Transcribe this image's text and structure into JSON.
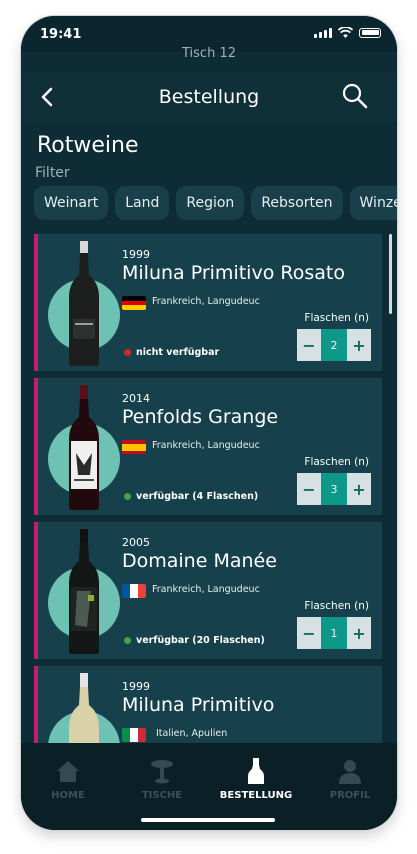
{
  "status_bar": {
    "time": "19:41"
  },
  "table_label": "Tisch 12",
  "header": {
    "title": "Bestellung"
  },
  "section": {
    "title": "Rotweine",
    "filter_label": "Filter"
  },
  "filters": [
    "Weinart",
    "Land",
    "Region",
    "Rebsorten",
    "Winze"
  ],
  "wines": [
    {
      "year": "1999",
      "name": "Miluna Primitivo Rosato",
      "origin": "Frankreich, Langudeuc",
      "flag": "de-flag-icon",
      "status": "nicht verfügbar",
      "status_color": "#d22a2a",
      "qty_label": "Flaschen (n)",
      "qty": "2",
      "bottle": "white"
    },
    {
      "year": "2014",
      "name": "Penfolds Grange",
      "origin": "Frankreich, Langudeuc",
      "flag": "es-flag-icon",
      "status": "verfügbar (4 Flaschen)",
      "status_color": "#3da641",
      "qty_label": "Flaschen (n)",
      "qty": "3",
      "bottle": "red"
    },
    {
      "year": "2005",
      "name": "Domaine Manée",
      "origin": "Frankreich, Langudeuc",
      "flag": "fr-flag-icon",
      "status": "verfügbar (20 Flaschen)",
      "status_color": "#3da641",
      "qty_label": "Flaschen (n)",
      "qty": "1",
      "bottle": "dark"
    },
    {
      "year": "1999",
      "name": "Miluna Primitivo",
      "origin": "Italien, Apulien",
      "flag": "it-flag-icon",
      "status": "",
      "status_color": "#3da641",
      "qty_label": "",
      "qty": "",
      "bottle": "white"
    }
  ],
  "tabs": [
    {
      "label": "HOME",
      "icon": "home-icon"
    },
    {
      "label": "TISCHE",
      "icon": "table-icon"
    },
    {
      "label": "BESTELLUNG",
      "icon": "bottle-icon"
    },
    {
      "label": "PROFIL",
      "icon": "user-icon"
    }
  ],
  "colors": {
    "accent": "#c21e6e",
    "teal": "#0f978a",
    "background": "#0e2c36"
  }
}
